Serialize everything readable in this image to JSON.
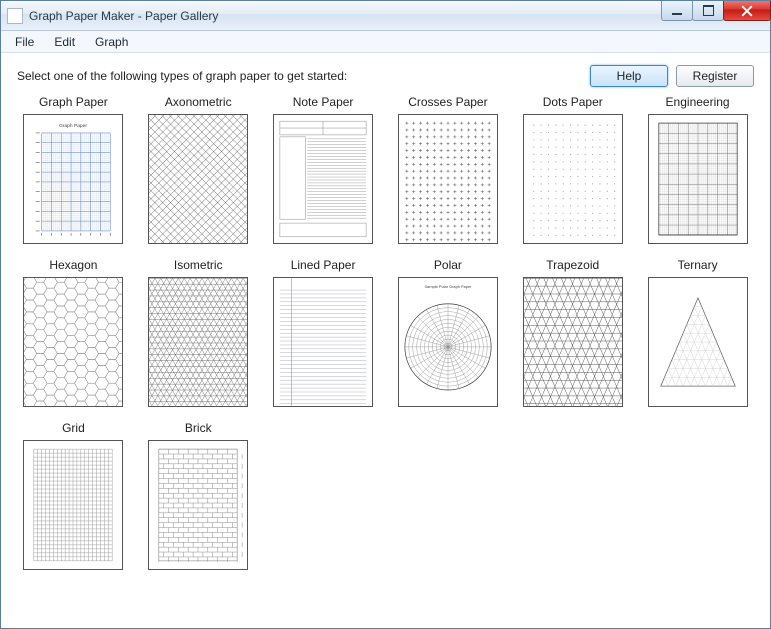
{
  "window": {
    "title": "Graph Paper Maker - Paper Gallery"
  },
  "menu": {
    "items": [
      "File",
      "Edit",
      "Graph"
    ]
  },
  "toolbar": {
    "prompt": "Select one of the following types of graph paper to get started:",
    "help_label": "Help",
    "register_label": "Register"
  },
  "gallery": {
    "items": [
      {
        "label": "Graph Paper",
        "type": "graph"
      },
      {
        "label": "Axonometric",
        "type": "axon"
      },
      {
        "label": "Note Paper",
        "type": "note"
      },
      {
        "label": "Crosses Paper",
        "type": "crosses"
      },
      {
        "label": "Dots Paper",
        "type": "dots"
      },
      {
        "label": "Engineering",
        "type": "engineering"
      },
      {
        "label": "Hexagon",
        "type": "hexagon"
      },
      {
        "label": "Isometric",
        "type": "isometric"
      },
      {
        "label": "Lined Paper",
        "type": "lined"
      },
      {
        "label": "Polar",
        "type": "polar"
      },
      {
        "label": "Trapezoid",
        "type": "trapezoid"
      },
      {
        "label": "Ternary",
        "type": "ternary"
      },
      {
        "label": "Grid",
        "type": "grid"
      },
      {
        "label": "Brick",
        "type": "brick"
      }
    ]
  }
}
